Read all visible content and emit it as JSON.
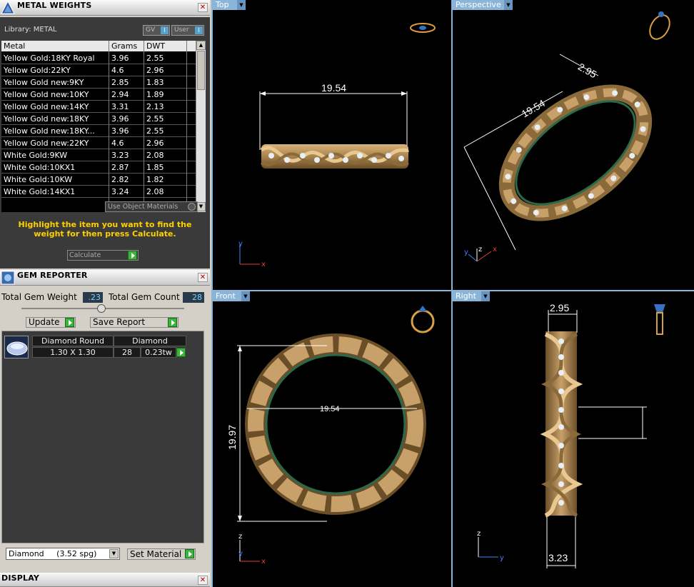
{
  "metal_panel": {
    "title": "METAL WEIGHTS",
    "library_label": "Library: METAL",
    "gv_label": "GV",
    "user_label": "User",
    "columns": [
      "Metal",
      "Grams",
      "DWT"
    ],
    "rows": [
      [
        "Yellow Gold:18KY Royal",
        "3.96",
        "2.55"
      ],
      [
        "Yellow Gold:22KY",
        "4.6",
        "2.96"
      ],
      [
        "Yellow Gold new:9KY",
        "2.85",
        "1.83"
      ],
      [
        "Yellow Gold new:10KY",
        "2.94",
        "1.89"
      ],
      [
        "Yellow Gold new:14KY",
        "3.31",
        "2.13"
      ],
      [
        "Yellow Gold new:18KY",
        "3.96",
        "2.55"
      ],
      [
        "Yellow Gold new:18KY...",
        "3.96",
        "2.55"
      ],
      [
        "Yellow Gold new:22KY",
        "4.6",
        "2.96"
      ],
      [
        "White Gold:9KW",
        "3.23",
        "2.08"
      ],
      [
        "White Gold:10KX1",
        "2.87",
        "1.85"
      ],
      [
        "White Gold:10KW",
        "2.82",
        "1.82"
      ],
      [
        "White Gold:14KX1",
        "3.24",
        "2.08"
      ]
    ],
    "use_object_materials": "Use Object Materials",
    "hint": "Highlight the item you want to find the weight for then press Calculate.",
    "calculate_label": "Calculate"
  },
  "gem_panel": {
    "title": "GEM REPORTER",
    "total_weight_label": "Total Gem Weight",
    "total_weight": ".23",
    "total_count_label": "Total Gem Count",
    "total_count": "28",
    "update_label": "Update",
    "save_report_label": "Save Report",
    "gem": {
      "shape": "Diamond Round",
      "material": "Diamond",
      "size": "1.30 X 1.30",
      "count": "28",
      "weight": "0.23tw"
    },
    "material_select": "Diamond     (3.52 spg)",
    "set_material_label": "Set Material"
  },
  "display_panel": {
    "title": "DISPLAY"
  },
  "viewports": {
    "top": {
      "label": "Top",
      "dim_width": "19.54"
    },
    "perspective": {
      "label": "Perspective",
      "dim_a": "19.54",
      "dim_b": "2.95"
    },
    "front": {
      "label": "Front",
      "dim_width": "19.54",
      "dim_height": "19.97"
    },
    "right": {
      "label": "Right",
      "dim_top": "2.95",
      "dim_bottom": "3.23"
    }
  },
  "colors": {
    "accent": "#8ab4d8",
    "gold": "#b8935a",
    "hint": "#ffd000",
    "axis_x": "#e04040",
    "axis_y": "#4080ff"
  }
}
